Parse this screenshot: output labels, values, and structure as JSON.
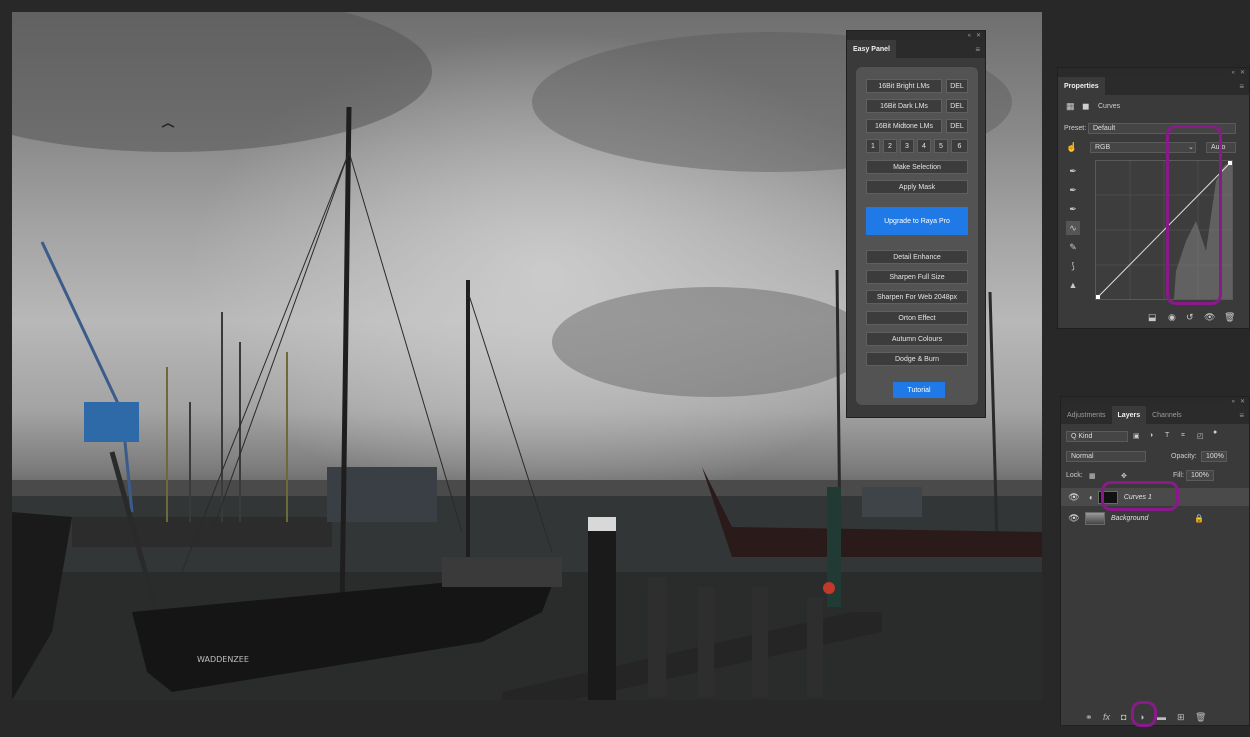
{
  "easy_panel": {
    "title": "Easy Panel",
    "buttons": {
      "bright": "16Bit Bright LMs",
      "dark": "16Bit Dark LMs",
      "midtone": "16Bit Midtone LMs",
      "del": "DEL",
      "numbers": [
        "1",
        "2",
        "3",
        "4",
        "5",
        "6"
      ],
      "make_selection": "Make Selection",
      "apply_mask": "Apply Mask",
      "upgrade": "Upgrade to Raya Pro",
      "detail": "Detail Enhance",
      "sharpen_full": "Sharpen Full Size",
      "sharpen_web": "Sharpen For Web 2048px",
      "orton": "Orton Effect",
      "autumn": "Autumn Colours",
      "dodge": "Dodge & Burn",
      "tutorial": "Tutorial"
    }
  },
  "properties": {
    "tab": "Properties",
    "layer_type": "Curves",
    "preset_label": "Preset:",
    "preset_value": "Default",
    "channel": "RGB",
    "auto": "Auto"
  },
  "layers_panel": {
    "tabs": [
      "Adjustments",
      "Layers",
      "Channels"
    ],
    "kind": "Q Kind",
    "blend_mode": "Normal",
    "opacity_label": "Opacity:",
    "opacity_value": "100%",
    "lock_label": "Lock:",
    "fill_label": "Fill:",
    "fill_value": "100%",
    "layers": [
      {
        "name": "Curves 1"
      },
      {
        "name": "Background"
      }
    ]
  },
  "photo": {
    "boat_name": "WADDENZEE"
  },
  "colors": {
    "accent_blue": "#1f7ae8",
    "annotation_purple": "#8a1a8a",
    "panel_bg": "#3a3a3a"
  }
}
